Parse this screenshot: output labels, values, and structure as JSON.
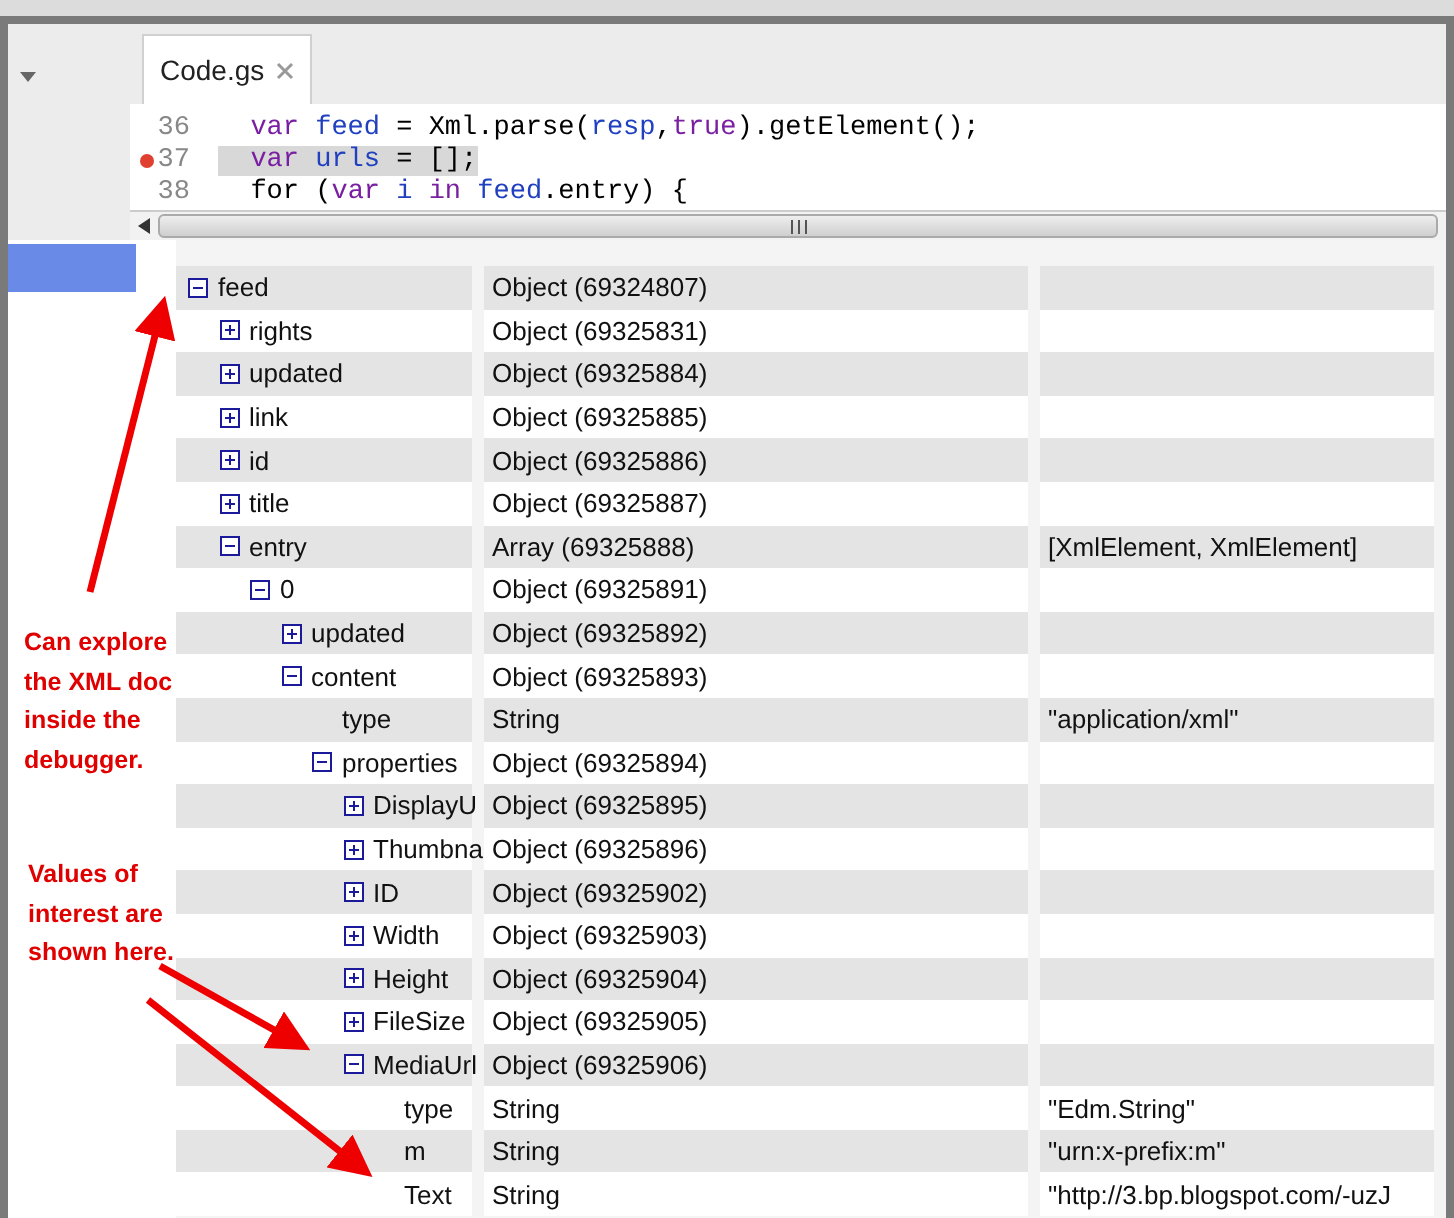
{
  "editor": {
    "tabs": [
      {
        "label": "Code.gs",
        "selected": true
      }
    ],
    "lines": [
      {
        "number": "36",
        "breakpoint": false,
        "highlighted": false,
        "tokens": [
          {
            "text": "  var ",
            "kind": "keyword"
          },
          {
            "text": "feed",
            "kind": "variable"
          },
          {
            "text": " = Xml.parse(",
            "kind": "plain"
          },
          {
            "text": "resp",
            "kind": "variable"
          },
          {
            "text": ",",
            "kind": "plain"
          },
          {
            "text": "true",
            "kind": "keyword"
          },
          {
            "text": ").getElement();",
            "kind": "plain"
          }
        ]
      },
      {
        "number": "37",
        "breakpoint": true,
        "highlighted": true,
        "tokens": [
          {
            "text": "  var ",
            "kind": "keyword"
          },
          {
            "text": "urls",
            "kind": "variable"
          },
          {
            "text": " = [];",
            "kind": "plain"
          }
        ]
      },
      {
        "number": "38",
        "breakpoint": false,
        "highlighted": false,
        "tokens": [
          {
            "text": "  for (",
            "kind": "plain"
          },
          {
            "text": "var ",
            "kind": "keyword"
          },
          {
            "text": "i ",
            "kind": "variable"
          },
          {
            "text": "in ",
            "kind": "keyword"
          },
          {
            "text": "feed",
            "kind": "variable"
          },
          {
            "text": ".entry) {",
            "kind": "plain"
          }
        ]
      }
    ]
  },
  "debugger": {
    "tree": [
      {
        "name": "feed",
        "type": "Object (69324807)",
        "expanded": true,
        "children": [
          {
            "name": "rights",
            "type": "Object (69325831)",
            "expanded": false
          },
          {
            "name": "updated",
            "type": "Object (69325884)",
            "expanded": false
          },
          {
            "name": "link",
            "type": "Object (69325885)",
            "expanded": false
          },
          {
            "name": "id",
            "type": "Object (69325886)",
            "expanded": false
          },
          {
            "name": "title",
            "type": "Object (69325887)",
            "expanded": false
          },
          {
            "name": "entry",
            "type": "Array (69325888)",
            "value": "[XmlElement, XmlElement]",
            "expanded": true,
            "children": [
              {
                "name": "0",
                "type": "Object (69325891)",
                "expanded": true,
                "children": [
                  {
                    "name": "updated",
                    "type": "Object (69325892)",
                    "expanded": false
                  },
                  {
                    "name": "content",
                    "type": "Object (69325893)",
                    "expanded": true,
                    "children": [
                      {
                        "name": "type",
                        "type": "String",
                        "value": "\"application/xml\""
                      },
                      {
                        "name": "properties",
                        "type": "Object (69325894)",
                        "expanded": true,
                        "children": [
                          {
                            "name": "DisplayU",
                            "type": "Object (69325895)",
                            "expanded": false
                          },
                          {
                            "name": "Thumbna",
                            "type": "Object (69325896)",
                            "expanded": false
                          },
                          {
                            "name": "ID",
                            "type": "Object (69325902)",
                            "expanded": false
                          },
                          {
                            "name": "Width",
                            "type": "Object (69325903)",
                            "expanded": false
                          },
                          {
                            "name": "Height",
                            "type": "Object (69325904)",
                            "expanded": false
                          },
                          {
                            "name": "FileSize",
                            "type": "Object (69325905)",
                            "expanded": false
                          },
                          {
                            "name": "MediaUrl",
                            "type": "Object (69325906)",
                            "expanded": true,
                            "children": [
                              {
                                "name": "type",
                                "type": "String",
                                "value": "\"Edm.String\""
                              },
                              {
                                "name": "m",
                                "type": "String",
                                "value": "\"urn:x-prefix:m\""
                              },
                              {
                                "name": "Text",
                                "type": "String",
                                "value": "\"http://3.bp.blogspot.com/-uzJ"
                              }
                            ]
                          }
                        ]
                      }
                    ]
                  }
                ]
              }
            ]
          }
        ]
      }
    ]
  },
  "annotations": [
    {
      "text": "Can explore the XML doc inside the debugger."
    },
    {
      "text": "Values of interest are shown here."
    }
  ]
}
